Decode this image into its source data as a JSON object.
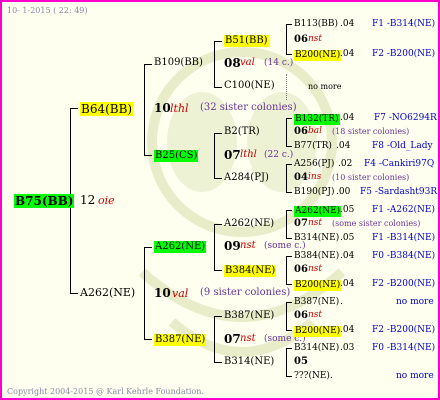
{
  "header": {
    "date_text": "10- 1-2015 ( 22: 49)"
  },
  "footer": {
    "copyright": "Copyright 2004-2015 @ Karl Kehrle Foundation."
  },
  "root": {
    "name": "B75(BB)",
    "year": "12",
    "line": "oie"
  },
  "gen1": {
    "father": {
      "name": "B64(BB)",
      "year": "10",
      "line": "lthl",
      "note": "(32 sister colonies)"
    },
    "mother": {
      "name": "A262(NE)",
      "year": "10",
      "line": "val",
      "note": "(9 sister colonies)"
    }
  },
  "gen2": {
    "ff": {
      "name": "B109(BB)",
      "year": "08",
      "line": "val",
      "note": "(14 c.)"
    },
    "fm": {
      "name": "B25(CS)",
      "year": "07",
      "line": "lthl",
      "note": "(22 c.)"
    },
    "mf": {
      "name": "A262(NE)",
      "year": "09",
      "line": "nst",
      "note": "(some c.)"
    },
    "mm": {
      "name": "B387(NE)",
      "year": "07",
      "line": "nst",
      "note": "(some c.)"
    }
  },
  "gen3": {
    "fff": {
      "name": "B51(BB)",
      "year": "06",
      "line": "nst"
    },
    "ffm": {
      "name": "C100(NE)",
      "note": "no more"
    },
    "fmf": {
      "name": "B2(TR)",
      "year": "06",
      "line": "bal",
      "note": "(18 sister colonies)"
    },
    "fmm": {
      "name": "A284(PJ)",
      "year": "04",
      "line": "ins",
      "note": "(10 sister colonies)"
    },
    "mff": {
      "name": "A262(NE)",
      "year": "07",
      "line": "nst",
      "note": "(some sister colonies)"
    },
    "mfm": {
      "name": "B384(NE)",
      "year": "06",
      "line": "nst"
    },
    "mmf": {
      "name": "B387(NE)",
      "year": "06",
      "line": "nst"
    },
    "mmm": {
      "name": "B314(NE)",
      "year": "05",
      "line": ""
    }
  },
  "gen4": [
    {
      "name": "B113(BB)",
      "year": ".04",
      "ref": "F1 -B314(NE)"
    },
    {
      "name": "B200(NE)",
      "year": ".04",
      "ref": "F2 -B200(NE)"
    },
    {
      "name": "B132(TR)",
      "year": ".04",
      "ref": "F7 -NO6294R"
    },
    {
      "name": "B77(TR)",
      "year": ".04",
      "ref": "F8 -Old_Lady"
    },
    {
      "name": "A256(PJ)",
      "year": ".02",
      "ref": "F4 -Cankiri97Q"
    },
    {
      "name": "B190(PJ)",
      "year": ".00",
      "ref": "F5 -Sardasht93R"
    },
    {
      "name": "A262(NE)",
      "year": ".05",
      "ref": "F1 -A262(NE)"
    },
    {
      "name": "B314(NE)",
      "year": ".05",
      "ref": "F1 -B314(NE)"
    },
    {
      "name": "B384(NE)",
      "year": ".04",
      "ref": "F0 -B384(NE)"
    },
    {
      "name": "B200(NE)",
      "year": ".04",
      "ref": "F2 -B200(NE)"
    },
    {
      "name": "B387(NE)",
      "year": ".",
      "ref": "no more"
    },
    {
      "name": "B200(NE)",
      "year": ".04",
      "ref": "F2 -B200(NE)"
    },
    {
      "name": "B314(NE)",
      "year": ".03",
      "ref": "F0 -B314(NE)"
    },
    {
      "name": "???(NE)",
      "year": ".",
      "ref": "no more"
    }
  ]
}
